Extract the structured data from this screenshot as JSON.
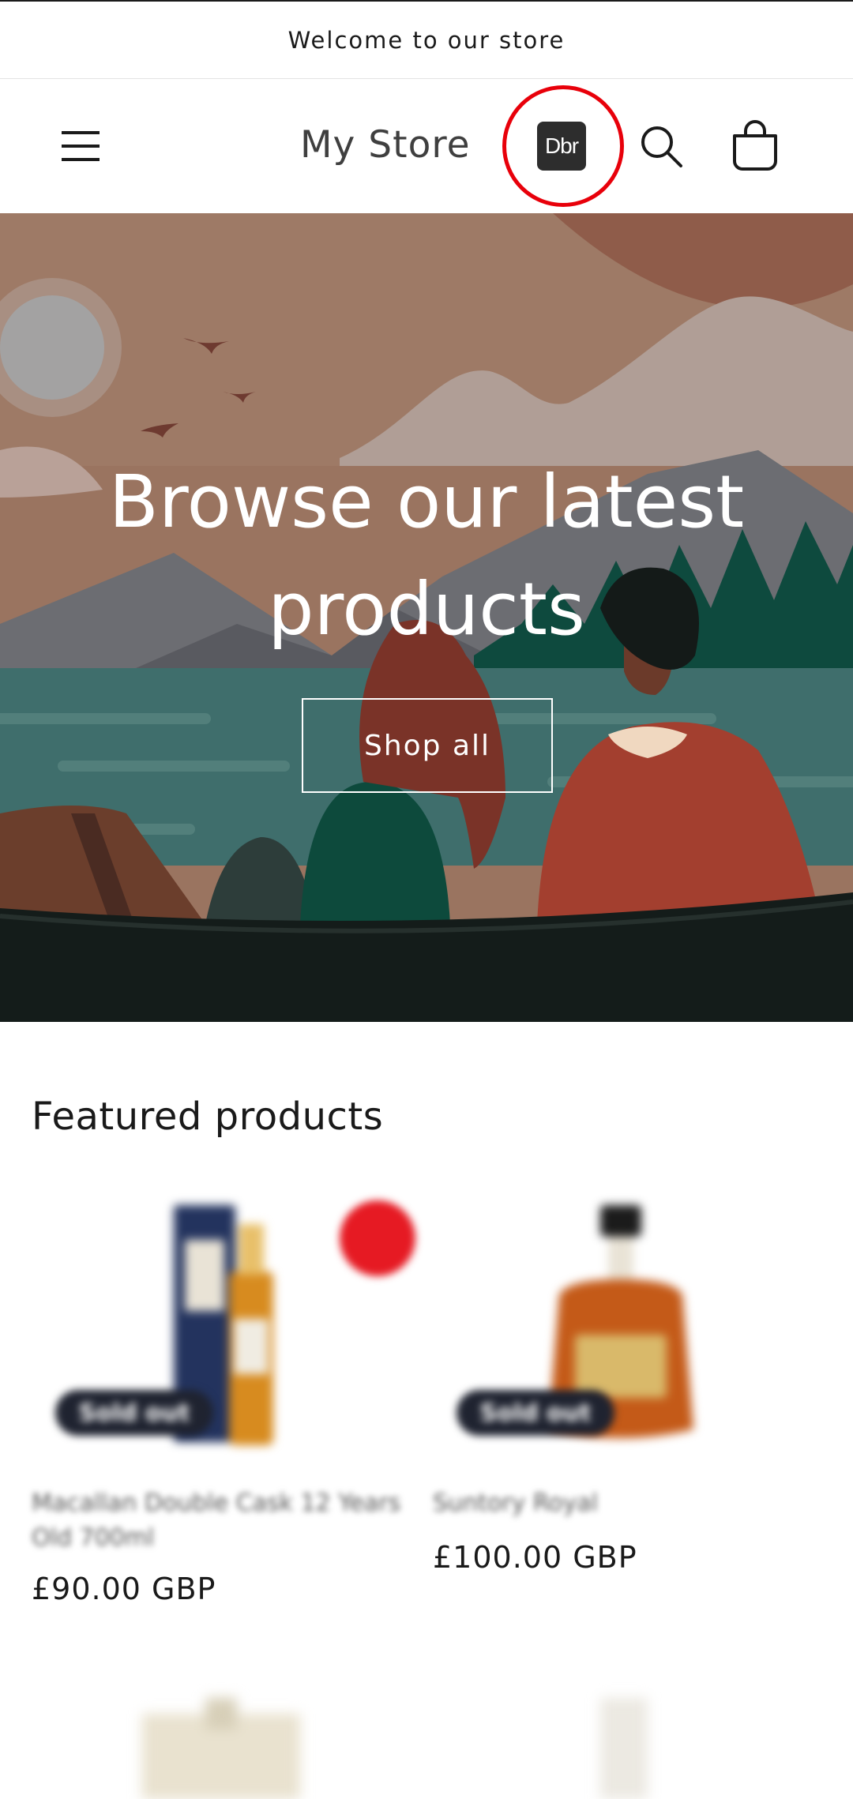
{
  "announcement": {
    "text": "Welcome to our store"
  },
  "header": {
    "store_name": "My Store",
    "app_icon_label": "Dbr",
    "menu_icon": "hamburger-menu-icon",
    "search_icon": "search-icon",
    "cart_icon": "cart-icon"
  },
  "hero": {
    "title": "Browse our latest products",
    "button_label": "Shop all"
  },
  "featured": {
    "title": "Featured products",
    "products": [
      {
        "name": "Macallan Double Cask 12 Years Old 700ml",
        "price": "£90.00 GBP",
        "badge": "Sold out"
      },
      {
        "name": "Suntory Royal",
        "price": "£100.00 GBP",
        "badge": "Sold out"
      }
    ]
  },
  "colors": {
    "highlight_ring": "#e8000a",
    "sold_out_badge": "#1f2330"
  }
}
